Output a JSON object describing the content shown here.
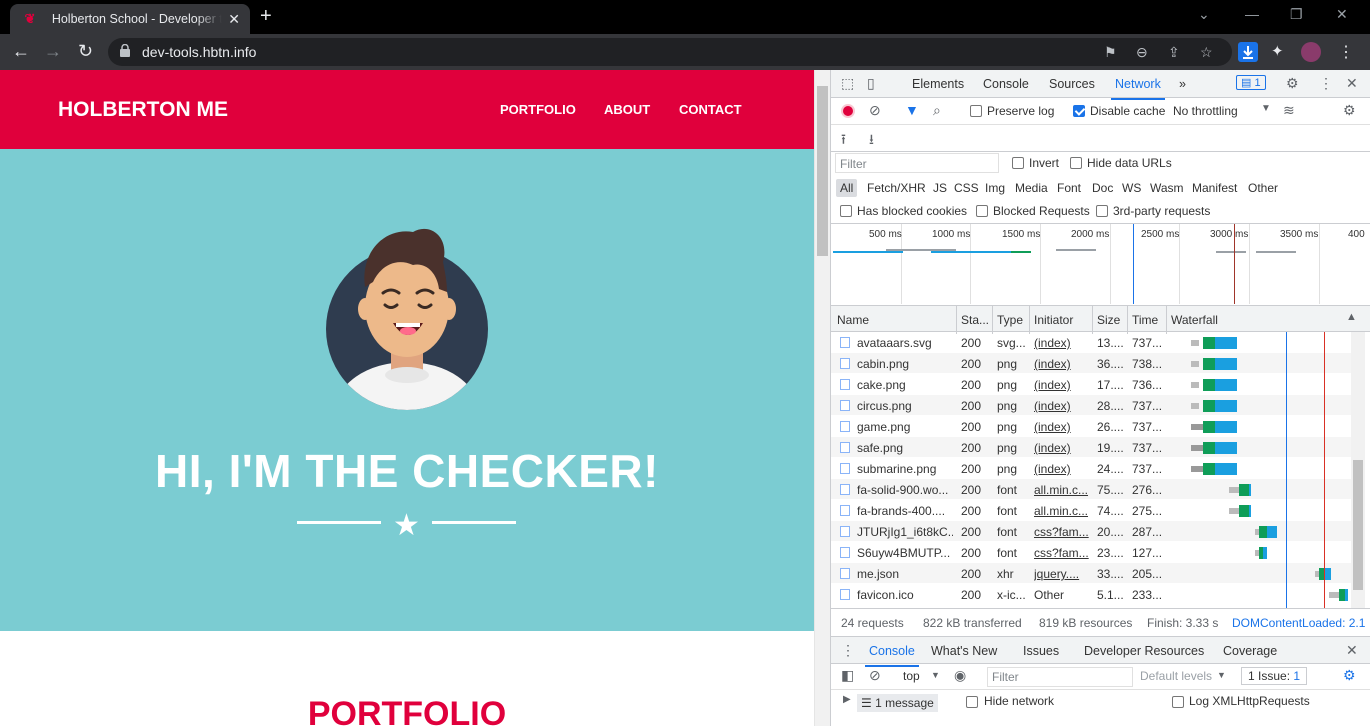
{
  "browser": {
    "tab_title": "Holberton School - Developer tools",
    "tab_close": "✕",
    "new_tab": "+",
    "url": "dev-tools.hbtn.info",
    "win_min": "—",
    "win_max": "❐",
    "win_close": "✕",
    "collapse": "⌄"
  },
  "site": {
    "brand": "HOLBERTON ME",
    "nav": [
      "PORTFOLIO",
      "ABOUT",
      "CONTACT"
    ],
    "hero_title": "HI, I'M THE CHECKER!",
    "section_title": "PORTFOLIO",
    "colors": {
      "primary": "#e0003c",
      "hero_bg": "#7bccd2"
    }
  },
  "devtools": {
    "tabs": [
      "Elements",
      "Console",
      "Sources",
      "Network"
    ],
    "active_tab": "Network",
    "more_tabs": "»",
    "issues_count": "1",
    "toolbar": {
      "preserve_log": "Preserve log",
      "disable_cache": "Disable cache",
      "throttling": "No throttling"
    },
    "filter": {
      "placeholder": "Filter",
      "invert": "Invert",
      "hide_data_urls": "Hide data URLs",
      "types": [
        "All",
        "Fetch/XHR",
        "JS",
        "CSS",
        "Img",
        "Media",
        "Font",
        "Doc",
        "WS",
        "Wasm",
        "Manifest",
        "Other"
      ],
      "has_blocked_cookies": "Has blocked cookies",
      "blocked_requests": "Blocked Requests",
      "third_party": "3rd-party requests"
    },
    "overview_ticks": [
      "500 ms",
      "1000 ms",
      "1500 ms",
      "2000 ms",
      "2500 ms",
      "3000 ms",
      "3500 ms",
      "400"
    ],
    "columns": [
      "Name",
      "Sta...",
      "Type",
      "Initiator",
      "Size",
      "Time",
      "Waterfall"
    ],
    "rows": [
      {
        "name": "avataaars.svg",
        "status": "200",
        "type": "svg...",
        "initiator": "(index)",
        "size": "13....",
        "time": "737..."
      },
      {
        "name": "cabin.png",
        "status": "200",
        "type": "png",
        "initiator": "(index)",
        "size": "36....",
        "time": "738..."
      },
      {
        "name": "cake.png",
        "status": "200",
        "type": "png",
        "initiator": "(index)",
        "size": "17....",
        "time": "736..."
      },
      {
        "name": "circus.png",
        "status": "200",
        "type": "png",
        "initiator": "(index)",
        "size": "28....",
        "time": "737..."
      },
      {
        "name": "game.png",
        "status": "200",
        "type": "png",
        "initiator": "(index)",
        "size": "26....",
        "time": "737..."
      },
      {
        "name": "safe.png",
        "status": "200",
        "type": "png",
        "initiator": "(index)",
        "size": "19....",
        "time": "737..."
      },
      {
        "name": "submarine.png",
        "status": "200",
        "type": "png",
        "initiator": "(index)",
        "size": "24....",
        "time": "737..."
      },
      {
        "name": "fa-solid-900.wo...",
        "status": "200",
        "type": "font",
        "initiator": "all.min.c...",
        "size": "75....",
        "time": "276..."
      },
      {
        "name": "fa-brands-400....",
        "status": "200",
        "type": "font",
        "initiator": "all.min.c...",
        "size": "74....",
        "time": "275..."
      },
      {
        "name": "JTURjIg1_i6t8kC...",
        "status": "200",
        "type": "font",
        "initiator": "css?fam...",
        "size": "20....",
        "time": "287..."
      },
      {
        "name": "S6uyw4BMUTP...",
        "status": "200",
        "type": "font",
        "initiator": "css?fam...",
        "size": "23....",
        "time": "127..."
      },
      {
        "name": "me.json",
        "status": "200",
        "type": "xhr",
        "initiator": "jquery....",
        "size": "33....",
        "time": "205..."
      },
      {
        "name": "favicon.ico",
        "status": "200",
        "type": "x-ic...",
        "initiator": "Other",
        "size": "5.1...",
        "time": "233..."
      }
    ],
    "status_bar": {
      "requests": "24 requests",
      "transferred": "822 kB transferred",
      "resources": "819 kB resources",
      "finish": "Finish: 3.33 s",
      "dom_loaded": "DOMContentLoaded: 2.1"
    },
    "drawer": {
      "tabs": [
        "Console",
        "What's New",
        "Issues",
        "Developer Resources",
        "Coverage"
      ],
      "context": "top",
      "filter_placeholder": "Filter",
      "levels": "Default levels",
      "issues": "1 Issue:",
      "issues_count": "1",
      "messages": "1 message",
      "hide_network": "Hide network",
      "log_xhr": "Log XMLHttpRequests"
    }
  }
}
